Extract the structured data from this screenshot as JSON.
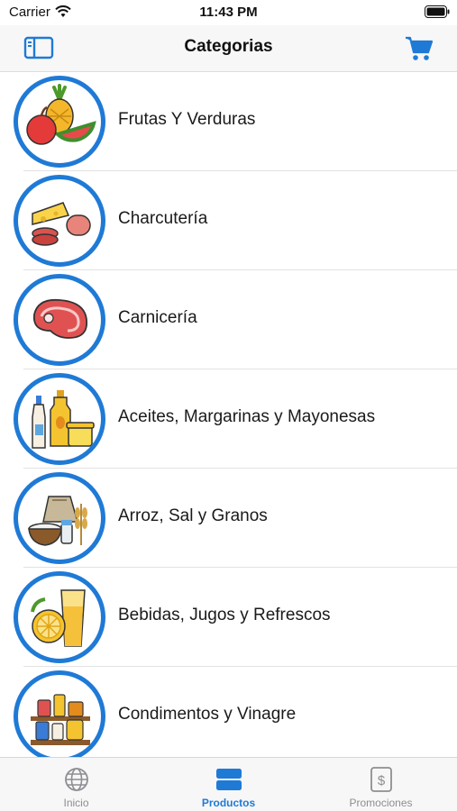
{
  "status_bar": {
    "carrier": "Carrier",
    "time": "11:43 PM"
  },
  "nav": {
    "title": "Categorias",
    "left_icon": "sidebar-icon",
    "right_icon": "cart-icon"
  },
  "colors": {
    "accent": "#1f7ad6",
    "inactive": "#8e8e93"
  },
  "categories": [
    {
      "label": "Frutas Y Verduras",
      "icon": "fruits-icon"
    },
    {
      "label": "Charcutería",
      "icon": "deli-icon"
    },
    {
      "label": "Carnicería",
      "icon": "meat-icon"
    },
    {
      "label": "Aceites, Margarinas y Mayonesas",
      "icon": "oils-icon"
    },
    {
      "label": "Arroz, Sal y Granos",
      "icon": "grains-icon"
    },
    {
      "label": "Bebidas, Jugos y Refrescos",
      "icon": "drinks-icon"
    },
    {
      "label": "Condimentos y Vinagre",
      "icon": "condiments-icon"
    }
  ],
  "tabs": [
    {
      "label": "Inicio",
      "icon": "globe-icon",
      "active": false
    },
    {
      "label": "Productos",
      "icon": "products-icon",
      "active": true
    },
    {
      "label": "Promociones",
      "icon": "dollar-icon",
      "active": false
    }
  ]
}
